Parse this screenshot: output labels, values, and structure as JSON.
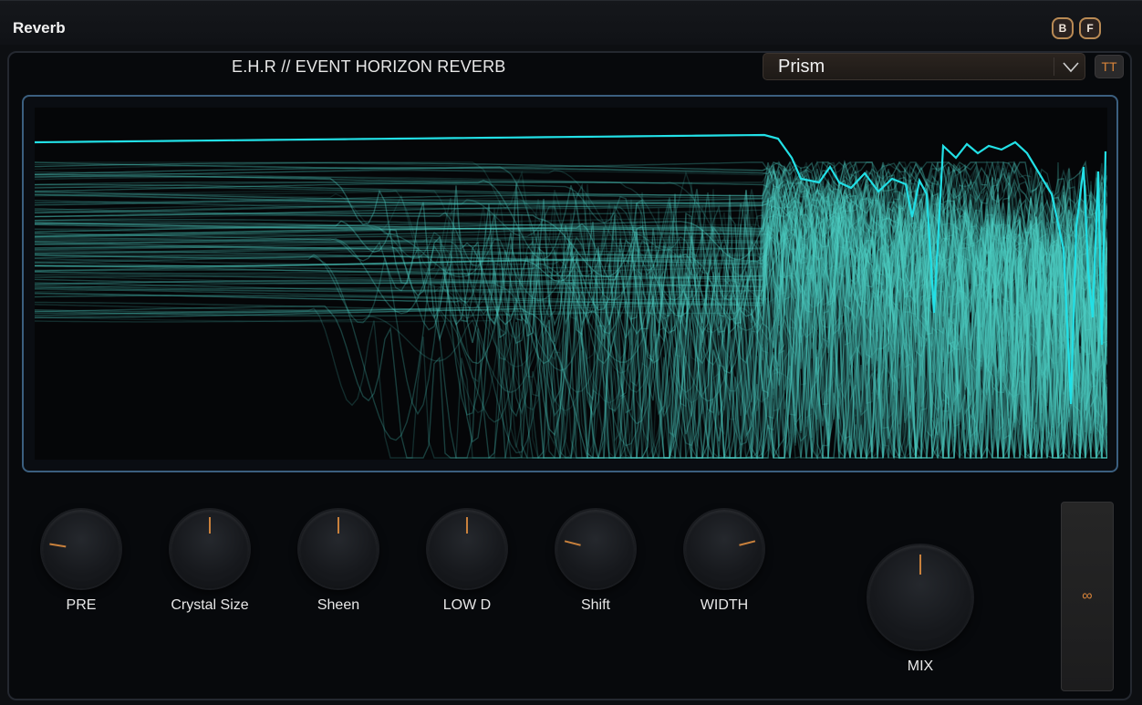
{
  "header": {
    "title": "Reverb",
    "buttons": [
      "B",
      "F"
    ]
  },
  "plugin": {
    "title": "E.H.R  //  EVENT HORIZON REVERB",
    "preset": {
      "value": "Prism"
    },
    "tt_label": "TT"
  },
  "knobs": [
    {
      "label": "PRE",
      "value": 0.2
    },
    {
      "label": "Crystal Size",
      "value": 0.5
    },
    {
      "label": "Sheen",
      "value": 0.5
    },
    {
      "label": "LOW D",
      "value": 0.5
    },
    {
      "label": "Shift",
      "value": 0.22
    },
    {
      "label": "WIDTH",
      "value": 0.78
    }
  ],
  "mix": {
    "label": "MIX",
    "value": 0.5
  },
  "side_panel": {
    "symbol": "∞"
  },
  "colors": {
    "accent": "#d9843a",
    "viz": "#22e0e6",
    "viz_trace": "#4fd3c8"
  }
}
